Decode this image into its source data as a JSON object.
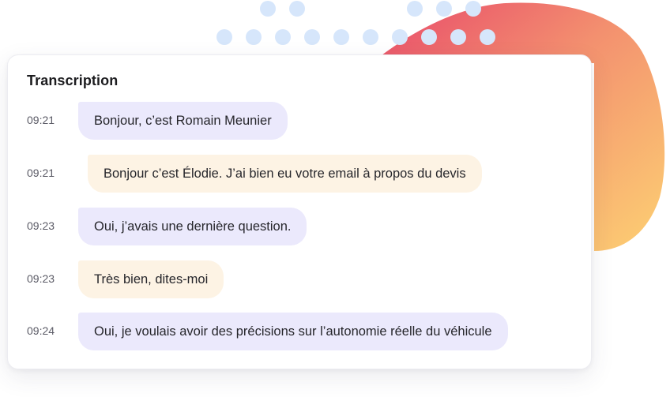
{
  "transcription": {
    "title": "Transcription",
    "messages": [
      {
        "time": "09:21",
        "text": "Bonjour, c’est Romain Meunier",
        "speaker": "agent"
      },
      {
        "time": "09:21",
        "text": "Bonjour c’est Élodie. J’ai bien eu votre email à propos du devis",
        "speaker": "client"
      },
      {
        "time": "09:23",
        "text": "Oui, j’avais une dernière question.",
        "speaker": "agent"
      },
      {
        "time": "09:23",
        "text": "Très bien, dites-moi",
        "speaker": "client"
      },
      {
        "time": "09:24",
        "text": "Oui, je voulais avoir des précisions sur l’autonomie réelle du véhicule",
        "speaker": "agent"
      }
    ]
  },
  "colors": {
    "agent_bubble": "#ebe9fc",
    "client_bubble": "#fdf3e4",
    "blob_gradient_start": "#e8486a",
    "blob_gradient_end": "#fdd173",
    "dots": "#d6e6fb"
  }
}
